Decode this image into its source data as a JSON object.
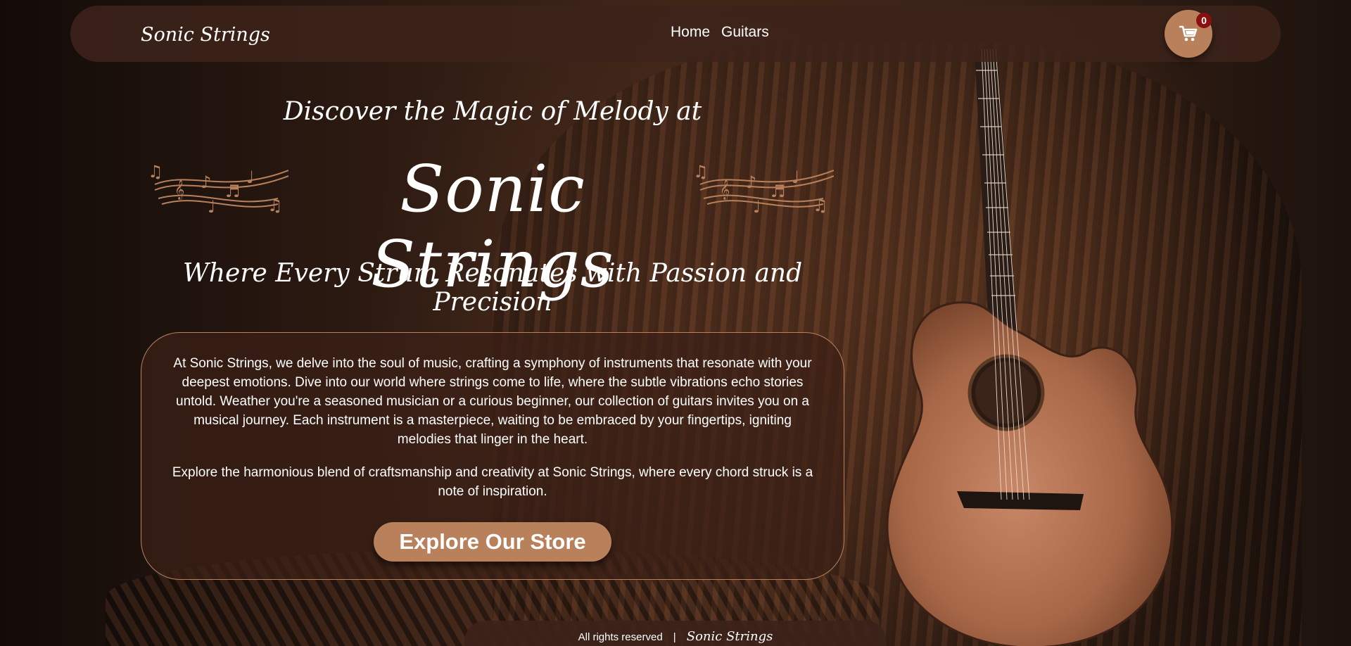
{
  "nav": {
    "brand": "Sonic Strings",
    "links": [
      {
        "label": "Home"
      },
      {
        "label": "Guitars"
      }
    ],
    "cart": {
      "icon": "cart-icon",
      "count": "0"
    }
  },
  "hero": {
    "tagline_top": "Discover the Magic of Melody at",
    "title": "Sonic Strings",
    "tagline_sub": "Where Every Strum Resonates with Passion and Precision"
  },
  "about": {
    "paragraph1": "At Sonic Strings, we delve into the soul of music, crafting a symphony of instruments that resonate with your deepest emotions. Dive into our world where strings come to life, where the subtle vibrations echo stories untold. Weather you're a seasoned musician or a curious beginner, our collection of guitars invites you on a musical journey. Each instrument is a masterpiece, waiting to be embraced by your fingertips, igniting melodies that linger in the heart.",
    "paragraph2": "Explore the harmonious blend of craftsmanship and creativity at Sonic Strings, where every chord struck is a note of inspiration.",
    "cta": "Explore Our Store"
  },
  "footer": {
    "text": "All rights reserved",
    "separator": "|",
    "brand": "Sonic Strings"
  },
  "colors": {
    "accent": "#b8815c",
    "badge": "#8a0f0f",
    "nav_bg": "#3c231a"
  }
}
